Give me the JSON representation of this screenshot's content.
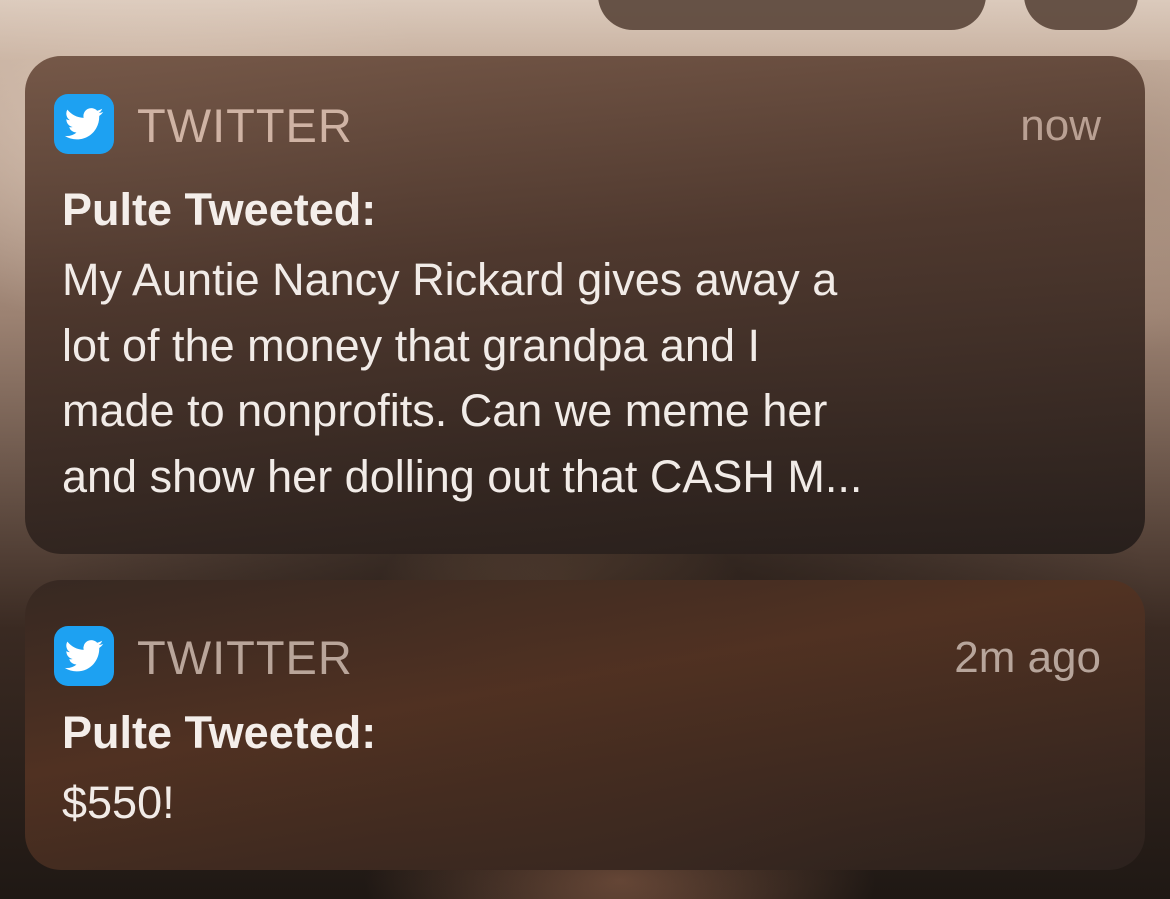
{
  "notifications": [
    {
      "app_name": "TWITTER",
      "app_icon": "twitter-bird-icon",
      "timestamp": "now",
      "title": "Pulte Tweeted:",
      "body_lines": [
        "My Auntie Nancy Rickard gives away a",
        "lot of the money that grandpa and I",
        "made to nonprofits. Can we meme her",
        "and show her dolling out that CASH M..."
      ]
    },
    {
      "app_name": "TWITTER",
      "app_icon": "twitter-bird-icon",
      "timestamp": "2m ago",
      "title": "Pulte Tweeted:",
      "body_lines": [
        "$550!"
      ]
    }
  ],
  "colors": {
    "twitter_blue": "#1da1f2"
  }
}
